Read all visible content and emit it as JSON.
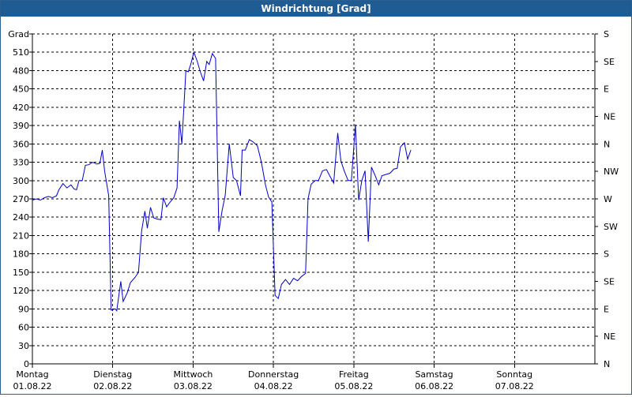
{
  "window": {
    "title": "Windrichtung [Grad]"
  },
  "chart_data": {
    "type": "line",
    "title": "Windrichtung [Grad]",
    "ylabel": "Grad",
    "ylim": [
      0,
      540
    ],
    "yticks": [
      0,
      30,
      60,
      90,
      120,
      150,
      180,
      210,
      240,
      270,
      300,
      330,
      360,
      390,
      420,
      450,
      480,
      510,
      540
    ],
    "y_tick_labels": [
      "0",
      "30",
      "60",
      "90",
      "120",
      "150",
      "180",
      "210",
      "240",
      "270",
      "300",
      "330",
      "360",
      "390",
      "420",
      "450",
      "480",
      "510",
      "Grad"
    ],
    "right_ticks": [
      0,
      45,
      90,
      135,
      180,
      225,
      270,
      315,
      360,
      405,
      450,
      495,
      540
    ],
    "right_labels": [
      "N",
      "NE",
      "E",
      "SE",
      "S",
      "SW",
      "W",
      "NW",
      "N",
      "NE",
      "E",
      "SE",
      "S"
    ],
    "xlim": [
      0,
      7
    ],
    "x_categories": [
      {
        "day": "Montag",
        "date": "01.08.22"
      },
      {
        "day": "Dienstag",
        "date": "02.08.22"
      },
      {
        "day": "Mittwoch",
        "date": "03.08.22"
      },
      {
        "day": "Donnerstag",
        "date": "04.08.22"
      },
      {
        "day": "Freitag",
        "date": "05.08.22"
      },
      {
        "day": "Samstag",
        "date": "06.08.22"
      },
      {
        "day": "Sonntag",
        "date": "07.08.22"
      }
    ],
    "grid": true,
    "series": [
      {
        "color": "#0000cc",
        "points": [
          [
            0.0,
            268
          ],
          [
            0.05,
            270
          ],
          [
            0.1,
            268
          ],
          [
            0.15,
            272
          ],
          [
            0.2,
            274
          ],
          [
            0.25,
            272
          ],
          [
            0.3,
            275
          ],
          [
            0.33,
            285
          ],
          [
            0.38,
            295
          ],
          [
            0.43,
            288
          ],
          [
            0.48,
            293
          ],
          [
            0.52,
            286
          ],
          [
            0.55,
            285
          ],
          [
            0.58,
            300
          ],
          [
            0.62,
            300
          ],
          [
            0.66,
            325
          ],
          [
            0.7,
            326
          ],
          [
            0.75,
            330
          ],
          [
            0.8,
            327
          ],
          [
            0.84,
            328
          ],
          [
            0.87,
            350
          ],
          [
            0.9,
            315
          ],
          [
            0.95,
            275
          ],
          [
            0.98,
            88
          ],
          [
            1.03,
            90
          ],
          [
            1.05,
            87
          ],
          [
            1.1,
            135
          ],
          [
            1.13,
            102
          ],
          [
            1.18,
            116
          ],
          [
            1.22,
            133
          ],
          [
            1.28,
            142
          ],
          [
            1.32,
            150
          ],
          [
            1.36,
            218
          ],
          [
            1.4,
            250
          ],
          [
            1.43,
            222
          ],
          [
            1.47,
            256
          ],
          [
            1.51,
            239
          ],
          [
            1.55,
            237
          ],
          [
            1.6,
            236
          ],
          [
            1.63,
            272
          ],
          [
            1.67,
            257
          ],
          [
            1.71,
            264
          ],
          [
            1.76,
            272
          ],
          [
            1.8,
            288
          ],
          [
            1.83,
            398
          ],
          [
            1.86,
            360
          ],
          [
            1.91,
            480
          ],
          [
            1.94,
            478
          ],
          [
            1.97,
            490
          ],
          [
            2.01,
            510
          ],
          [
            2.05,
            496
          ],
          [
            2.09,
            478
          ],
          [
            2.13,
            463
          ],
          [
            2.17,
            495
          ],
          [
            2.2,
            490
          ],
          [
            2.24,
            508
          ],
          [
            2.28,
            500
          ],
          [
            2.32,
            216
          ],
          [
            2.36,
            250
          ],
          [
            2.4,
            276
          ],
          [
            2.45,
            360
          ],
          [
            2.5,
            305
          ],
          [
            2.54,
            300
          ],
          [
            2.59,
            275
          ],
          [
            2.61,
            350
          ],
          [
            2.65,
            350
          ],
          [
            2.7,
            367
          ],
          [
            2.75,
            363
          ],
          [
            2.8,
            357
          ],
          [
            2.85,
            330
          ],
          [
            2.9,
            293
          ],
          [
            2.94,
            273
          ],
          [
            2.98,
            265
          ],
          [
            3.02,
            112
          ],
          [
            3.06,
            107
          ],
          [
            3.1,
            130
          ],
          [
            3.15,
            138
          ],
          [
            3.2,
            130
          ],
          [
            3.25,
            140
          ],
          [
            3.3,
            136
          ],
          [
            3.35,
            143
          ],
          [
            3.4,
            148
          ],
          [
            3.43,
            270
          ],
          [
            3.47,
            294
          ],
          [
            3.52,
            300
          ],
          [
            3.56,
            300
          ],
          [
            3.61,
            316
          ],
          [
            3.66,
            318
          ],
          [
            3.7,
            308
          ],
          [
            3.75,
            296
          ],
          [
            3.8,
            378
          ],
          [
            3.84,
            332
          ],
          [
            3.88,
            316
          ],
          [
            3.93,
            300
          ],
          [
            3.97,
            300
          ],
          [
            4.02,
            392
          ],
          [
            4.06,
            268
          ],
          [
            4.1,
            300
          ],
          [
            4.14,
            316
          ],
          [
            4.18,
            200
          ],
          [
            4.22,
            322
          ],
          [
            4.27,
            307
          ],
          [
            4.31,
            293
          ],
          [
            4.35,
            308
          ],
          [
            4.4,
            310
          ],
          [
            4.45,
            312
          ],
          [
            4.5,
            319
          ],
          [
            4.54,
            320
          ],
          [
            4.58,
            355
          ],
          [
            4.63,
            362
          ],
          [
            4.67,
            335
          ],
          [
            4.71,
            350
          ]
        ]
      }
    ]
  }
}
